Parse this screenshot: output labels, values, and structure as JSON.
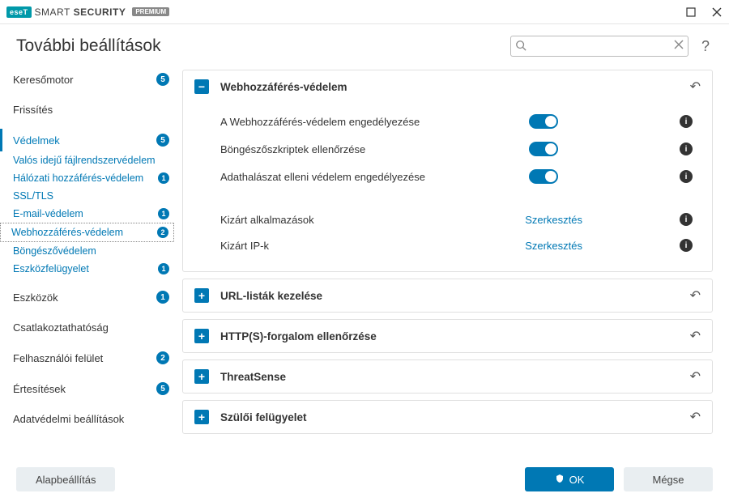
{
  "titlebar": {
    "brand_badge": "eseT",
    "brand_word1": "SMART",
    "brand_word2": "SECURITY",
    "premium": "PREMIUM"
  },
  "header": {
    "title": "További beállítások",
    "search_placeholder": "",
    "help": "?"
  },
  "sidebar": {
    "items": [
      {
        "label": "Keresőmotor",
        "badge": "5",
        "type": "top"
      },
      {
        "label": "Frissítés",
        "type": "top"
      },
      {
        "label": "Védelmek",
        "badge": "5",
        "type": "top",
        "active": true
      },
      {
        "label": "Valós idejű fájlrendszervédelem",
        "type": "sub"
      },
      {
        "label": "Hálózati hozzáférés-védelem",
        "badge": "1",
        "type": "sub"
      },
      {
        "label": "SSL/TLS",
        "type": "sub"
      },
      {
        "label": "E-mail-védelem",
        "badge": "1",
        "type": "sub"
      },
      {
        "label": "Webhozzáférés-védelem",
        "badge": "2",
        "type": "sub",
        "selected": true
      },
      {
        "label": "Böngészővédelem",
        "type": "sub"
      },
      {
        "label": "Eszközfelügyelet",
        "badge": "1",
        "type": "sub"
      },
      {
        "label": "Eszközök",
        "badge": "1",
        "type": "top"
      },
      {
        "label": "Csatlakoztathatóság",
        "type": "top"
      },
      {
        "label": "Felhasználói felület",
        "badge": "2",
        "type": "top"
      },
      {
        "label": "Értesítések",
        "badge": "5",
        "type": "top"
      },
      {
        "label": "Adatvédelmi beállítások",
        "type": "top"
      }
    ]
  },
  "content": {
    "panels": [
      {
        "title": "Webhozzáférés-védelem",
        "expanded": true,
        "rows": [
          {
            "label": "A Webhozzáférés-védelem engedélyezése",
            "control": "toggle",
            "value": true
          },
          {
            "label": "Böngészőszkriptek ellenőrzése",
            "control": "toggle",
            "value": true
          },
          {
            "label": "Adathalászat elleni védelem engedélyezése",
            "control": "toggle",
            "value": true
          },
          {
            "spacer": true
          },
          {
            "label": "Kizárt alkalmazások",
            "control": "link",
            "link_text": "Szerkesztés"
          },
          {
            "label": "Kizárt IP-k",
            "control": "link",
            "link_text": "Szerkesztés"
          }
        ]
      },
      {
        "title": "URL-listák kezelése",
        "expanded": false
      },
      {
        "title": "HTTP(S)-forgalom ellenőrzése",
        "expanded": false
      },
      {
        "title": "ThreatSense",
        "expanded": false
      },
      {
        "title": "Szülői felügyelet",
        "expanded": false
      }
    ]
  },
  "footer": {
    "default_btn": "Alapbeállítás",
    "ok_btn": "OK",
    "cancel_btn": "Mégse"
  }
}
